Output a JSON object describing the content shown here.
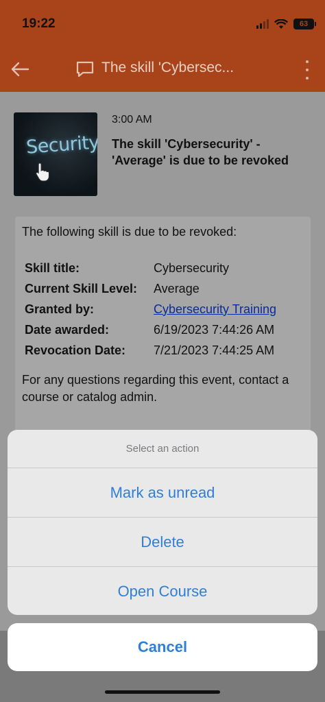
{
  "status_bar": {
    "time": "19:22",
    "battery": "63"
  },
  "app_bar": {
    "title": "The skill 'Cybersec..."
  },
  "message": {
    "time": "3:00 AM",
    "heading": "The skill 'Cybersecurity' - 'Average' is due to be revoked",
    "thumbnail_text": "Security"
  },
  "card": {
    "intro": "The following skill is due to be revoked:",
    "details": [
      {
        "label": "Skill title:",
        "value": "Cybersecurity"
      },
      {
        "label": "Current Skill Level:",
        "value": "Average"
      },
      {
        "label": "Granted by:",
        "value": "Cybersecurity Training"
      },
      {
        "label": "Date awarded:",
        "value": "6/19/2023 7:44:26 AM"
      },
      {
        "label": "Revocation Date:",
        "value": "7/21/2023 7:44:25 AM"
      }
    ],
    "footer": "For any questions regarding this event, contact a course or catalog admin."
  },
  "action_sheet": {
    "title": "Select an action",
    "actions": [
      "Mark as unread",
      "Delete",
      "Open Course"
    ],
    "cancel": "Cancel"
  },
  "colors": {
    "brand": "#a9431a",
    "action": "#2f7fd6",
    "link": "#0b2a9c"
  }
}
